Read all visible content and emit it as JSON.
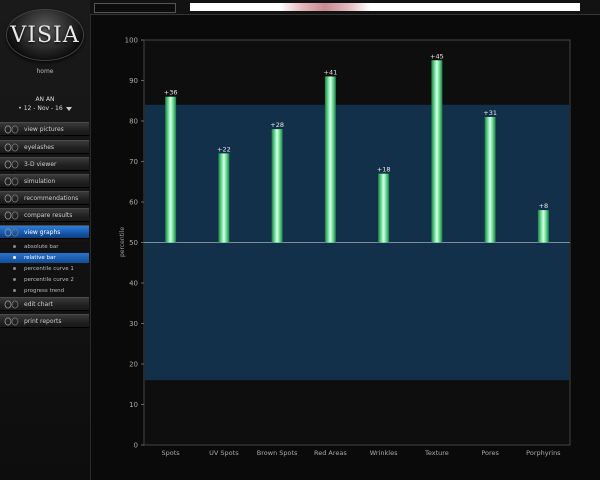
{
  "logo": {
    "text": "VISIA"
  },
  "sidebar": {
    "home": "home",
    "patient_name": "AN AN",
    "visit_date": "• 12 - Nov - 16",
    "nav": [
      {
        "label": "view pictures",
        "icon": "faces-icon"
      },
      {
        "label": "eyelashes",
        "icon": "eye-icon"
      },
      {
        "label": "3-D viewer",
        "icon": "3d-face-icon"
      },
      {
        "label": "simulation",
        "icon": "simulation-icon"
      },
      {
        "label": "recommendations",
        "icon": "recommendations-icon"
      },
      {
        "label": "compare results",
        "icon": "compare-icon"
      },
      {
        "label": "view graphs",
        "icon": "graph-icon",
        "active": true
      }
    ],
    "graph_options": [
      {
        "label": "absolute bar"
      },
      {
        "label": "relative bar",
        "active": true
      },
      {
        "label": "percentile curve 1"
      },
      {
        "label": "percentile curve 2"
      },
      {
        "label": "progress trend"
      }
    ],
    "nav_bottom": [
      {
        "label": "edit chart",
        "icon": "edit-chart-icon"
      },
      {
        "label": "print reports",
        "icon": "print-icon"
      }
    ]
  },
  "colors": {
    "band": "#13304a",
    "bar_light": "#d9ffe6",
    "bar_mid": "#5fd68c",
    "bar_dark": "#1f7a45",
    "active_blue": "#1a63b8"
  },
  "chart_data": {
    "type": "bar",
    "categories": [
      "Spots",
      "UV Spots",
      "Brown Spots",
      "Red Areas",
      "Wrinkles",
      "Texture",
      "Pores",
      "Porphyrins"
    ],
    "values": [
      86,
      72,
      78,
      91,
      67,
      95,
      81,
      58
    ],
    "data_labels": [
      "+36",
      "+22",
      "+28",
      "+41",
      "+18",
      "+45",
      "+31",
      "+8"
    ],
    "ylabel": "percentile",
    "ylim": [
      0,
      100
    ],
    "yticks": [
      0,
      10,
      20,
      30,
      40,
      50,
      60,
      70,
      80,
      90,
      100
    ],
    "baseline": 50,
    "band": [
      16,
      84
    ]
  }
}
